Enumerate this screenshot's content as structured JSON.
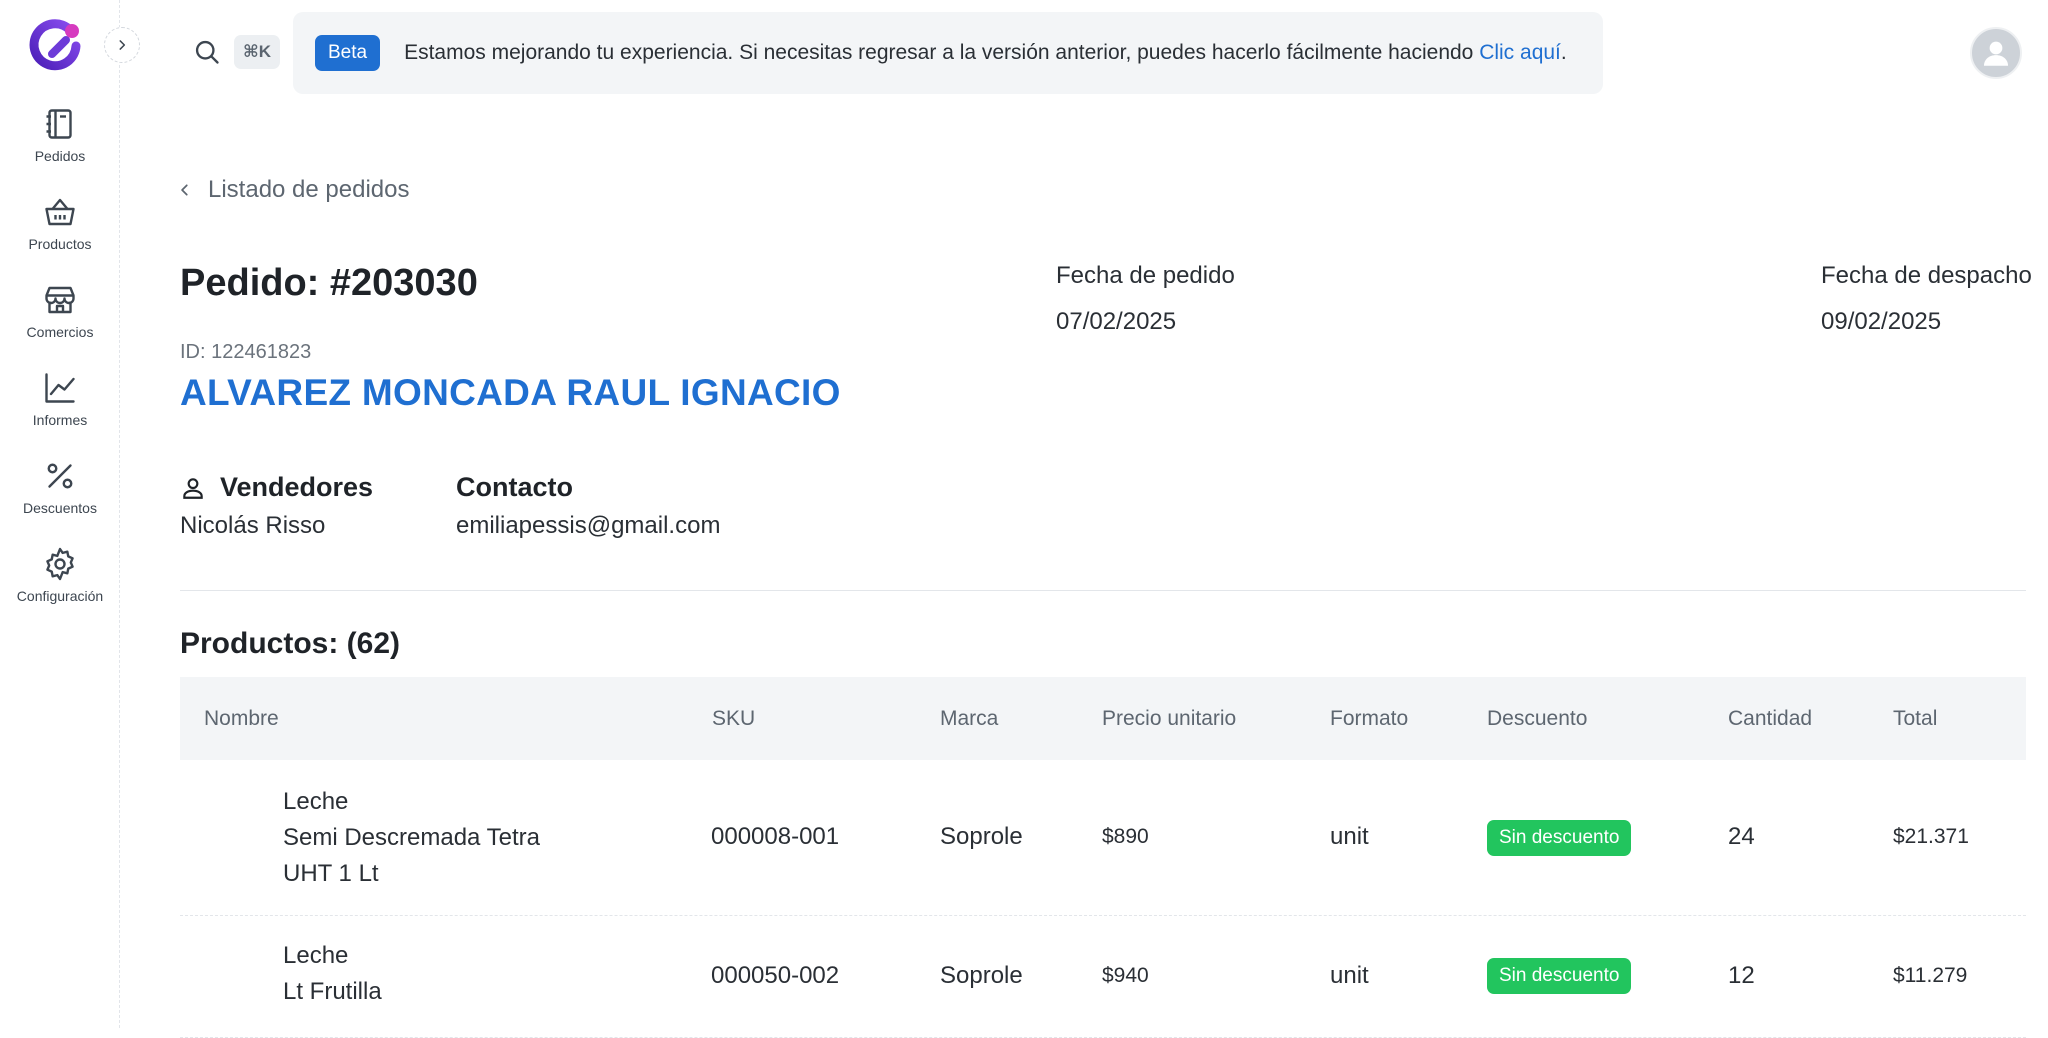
{
  "topbar": {
    "shortcut": "⌘K",
    "banner": {
      "badge": "Beta",
      "text": "Estamos mejorando tu experiencia. Si necesitas regresar a la versión anterior, puedes hacerlo fácilmente haciendo ",
      "link": "Clic aquí",
      "suffix": "."
    }
  },
  "sidebar": {
    "items": [
      {
        "label": "Pedidos",
        "icon": "notebook-icon"
      },
      {
        "label": "Productos",
        "icon": "basket-icon"
      },
      {
        "label": "Comercios",
        "icon": "store-icon"
      },
      {
        "label": "Informes",
        "icon": "line-chart-icon"
      },
      {
        "label": "Descuentos",
        "icon": "percent-icon"
      },
      {
        "label": "Configuración",
        "icon": "gear-icon"
      }
    ]
  },
  "order": {
    "back_label": "Listado de pedidos",
    "title": "Pedido: #203030",
    "id_label": "ID: 122461823",
    "customer": "ALVAREZ MONCADA RAUL IGNACIO",
    "order_date_label": "Fecha de pedido",
    "order_date": "07/02/2025",
    "dispatch_date_label": "Fecha de despacho",
    "dispatch_date": "09/02/2025",
    "sellers_label": "Vendedores",
    "seller": "Nicolás Risso",
    "contact_label": "Contacto",
    "contact": "emiliapessis@gmail.com"
  },
  "products": {
    "title": "Productos: (62)",
    "columns": [
      "Nombre",
      "SKU",
      "Marca",
      "Precio unitario",
      "Formato",
      "Descuento",
      "Cantidad",
      "Total"
    ],
    "rows": [
      {
        "name_lines": [
          "Leche",
          "Semi Descremada Tetra",
          "UHT 1 Lt"
        ],
        "sku": "000008-001",
        "brand": "Soprole",
        "price": "$890",
        "format": "unit",
        "discount": "Sin descuento",
        "qty": "24",
        "total": "$21.371"
      },
      {
        "name_lines": [
          "Leche",
          "Lt Frutilla"
        ],
        "sku": "000050-002",
        "brand": "Soprole",
        "price": "$940",
        "format": "unit",
        "discount": "Sin descuento",
        "qty": "12",
        "total": "$11.279"
      }
    ]
  },
  "colors": {
    "accent": "#1f6fd1",
    "success": "#22c55e",
    "logo_purple": "#6d3bd8"
  }
}
